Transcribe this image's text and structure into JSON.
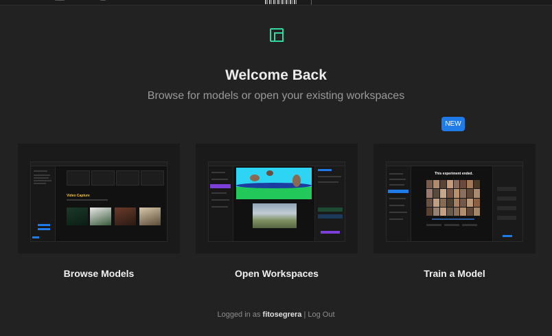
{
  "header": {
    "title": "Welcome Back",
    "subtitle": "Browse for models or open your existing workspaces"
  },
  "badge": {
    "label": "NEW"
  },
  "cards": [
    {
      "label": "Browse Models",
      "preview_heading": "Video Capture"
    },
    {
      "label": "Open Workspaces"
    },
    {
      "label": "Train a Model",
      "preview_heading": "This experiment ended."
    }
  ],
  "footer": {
    "prefix": "Logged in as",
    "username": "fitosegrera",
    "separator": "|",
    "logout": "Log Out"
  },
  "colors": {
    "background": "#222222",
    "card": "#1a1a1a",
    "accent_logo": "#33d7a0",
    "badge": "#1f7be8"
  },
  "icons": {
    "logo": "runway-logo-icon"
  }
}
